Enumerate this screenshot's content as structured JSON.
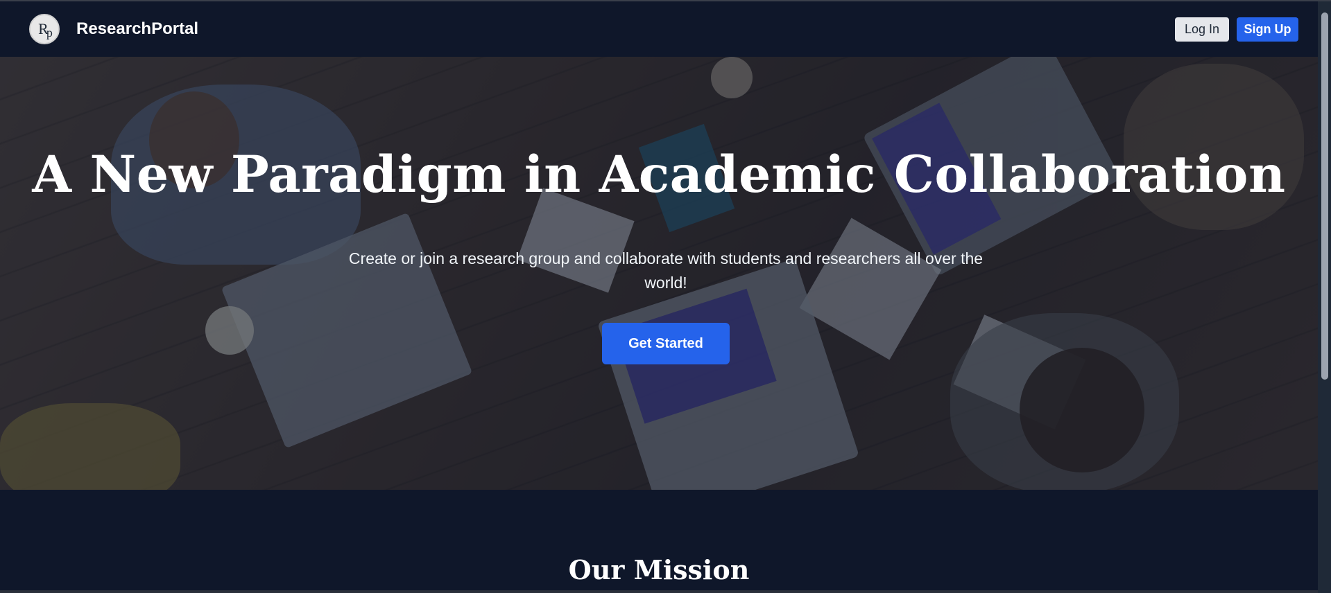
{
  "navbar": {
    "logo_text": "Rp",
    "brand": "ResearchPortal",
    "login_label": "Log In",
    "signup_label": "Sign Up"
  },
  "hero": {
    "title": "A New Paradigm in Academic Collaboration",
    "subtitle": "Create or join a research group and collaborate with students and researchers all over the world!",
    "cta_label": "Get Started",
    "background_image": "people-collaborating-at-table-with-laptops"
  },
  "mission": {
    "title": "Our Mission"
  },
  "colors": {
    "navy": "#0f172a",
    "primary": "#2563eb",
    "light_button": "#e5e7eb"
  }
}
